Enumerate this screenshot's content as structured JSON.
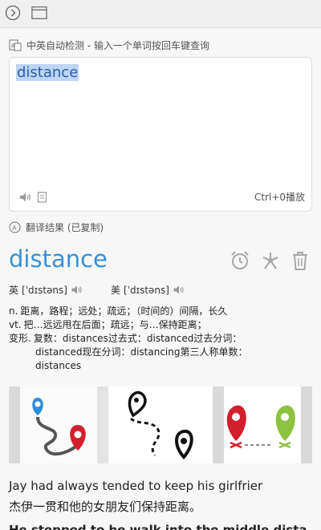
{
  "header": {
    "icons": [
      "forward-circle-icon",
      "window-icon"
    ]
  },
  "input": {
    "section_title": "中英自动检测 - 输入一个单词按回车键查询",
    "value": "distance",
    "play_hint": "Ctrl+0播放"
  },
  "result": {
    "section_title": "翻译结果 (已复制)",
    "word": "distance",
    "phonetics": {
      "uk_label": "英",
      "uk": "[ˈdɪstəns]",
      "us_label": "美",
      "us": "[ˈdɪstəns]"
    },
    "definitions": [
      {
        "pos": "n.",
        "text": "距离，路程；远处；疏远；（时间的）间隔，长久"
      },
      {
        "pos": "vt.",
        "text": "把…远远甩在后面；疏远；与…保持距离；"
      },
      {
        "pos": "变形.",
        "text": "复数：distances过去式：distanced过去分词："
      },
      {
        "pos": "",
        "text": "distanced现在分词：distancing第三人称单数："
      },
      {
        "pos": "",
        "text": "distances"
      }
    ]
  },
  "examples": {
    "en": "Jay had always tended to keep his girlfrier",
    "cn": "杰伊一贯和他的女朋友们保持距离。",
    "next_partial": "He stepped to he walk into the middle dista"
  },
  "colors": {
    "accent": "#3a8fd4",
    "pin_red": "#d21f2b",
    "pin_blue": "#2f8ed8",
    "pin_green": "#8cc23f"
  }
}
